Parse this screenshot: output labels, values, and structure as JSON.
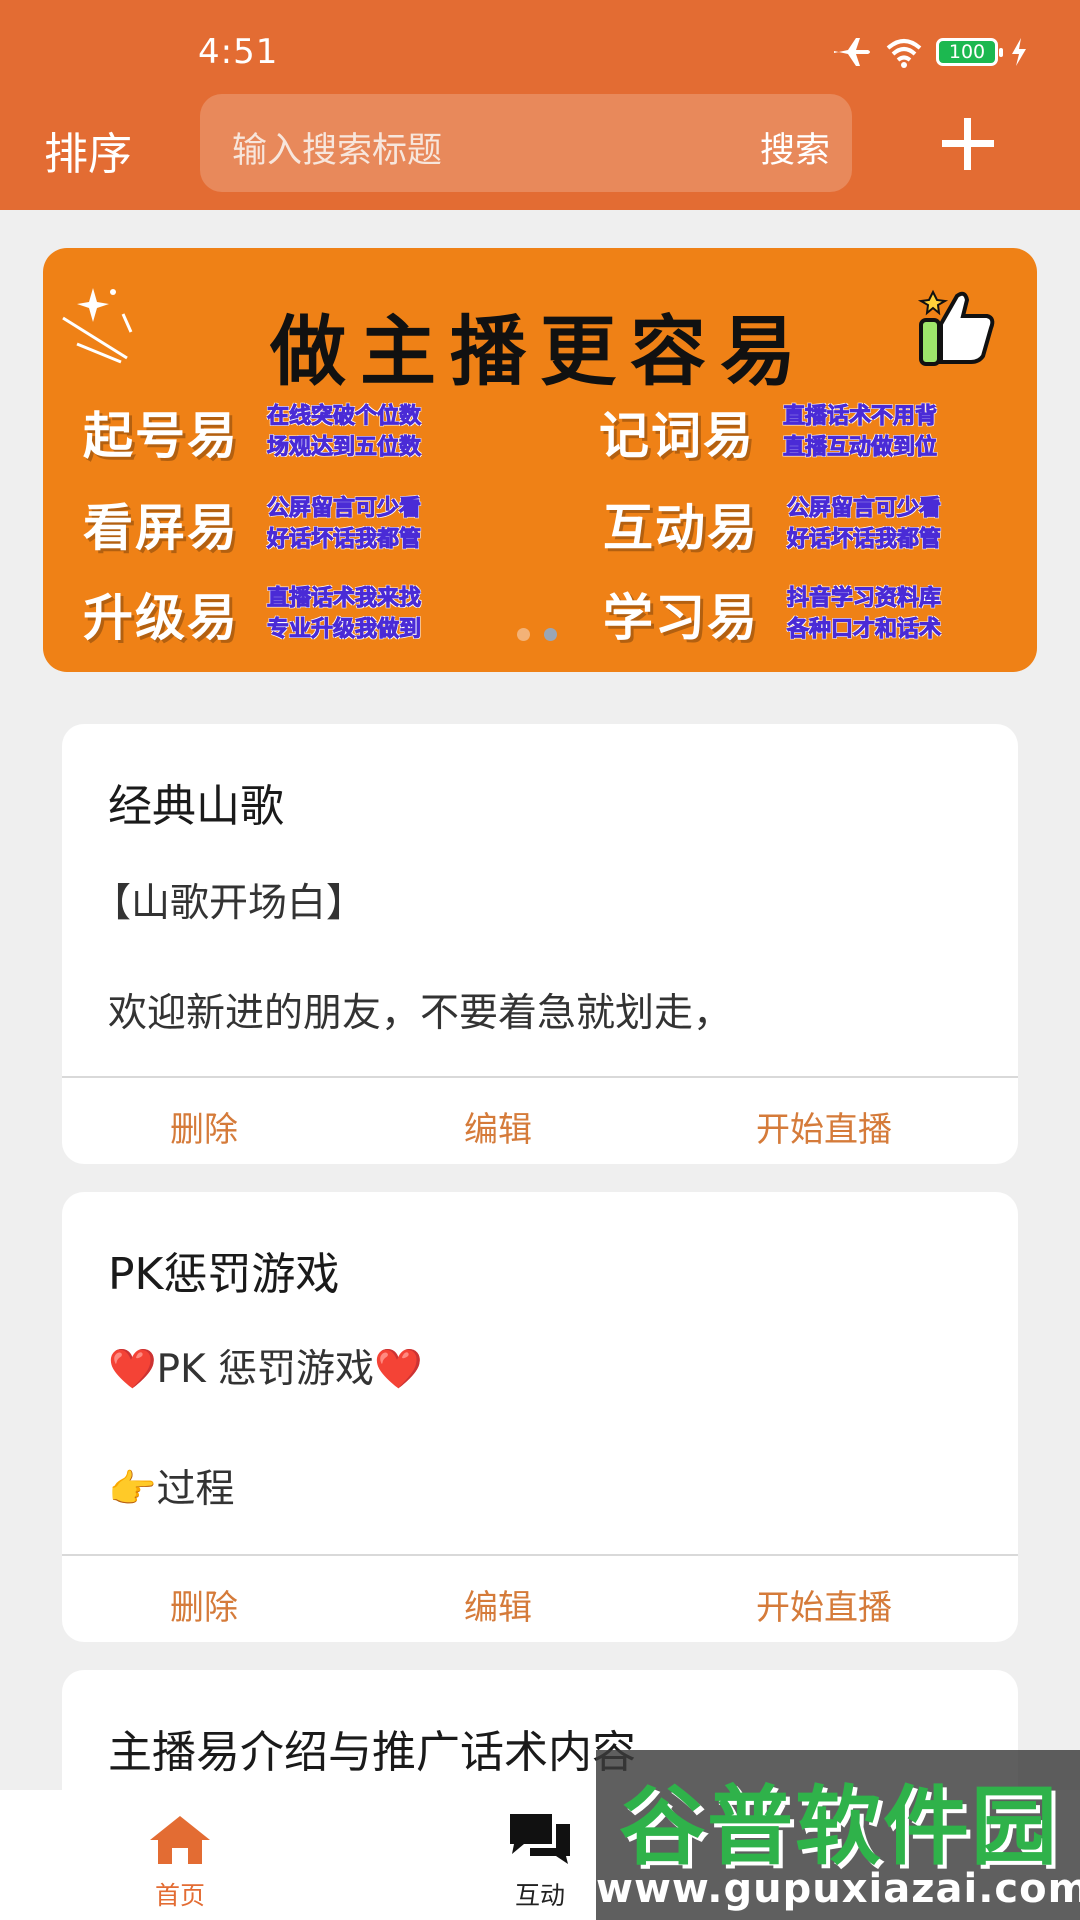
{
  "status_bar": {
    "time": "4:51",
    "battery": "100"
  },
  "header": {
    "sort_label": "排序",
    "search_placeholder": "输入搜索标题",
    "search_button": "搜索"
  },
  "banner": {
    "title": "做主播更容易",
    "cells": [
      {
        "big": "起号易",
        "line1": "在线突破个位数",
        "line2": "场观达到五位数"
      },
      {
        "big": "记词易",
        "line1": "直播话术不用背",
        "line2": "直播互动做到位"
      },
      {
        "big": "看屏易",
        "line1": "公屏留言可少看",
        "line2": "好话坏话我都管"
      },
      {
        "big": "互动易",
        "line1": "公屏留言可少看",
        "line2": "好话坏话我都管"
      },
      {
        "big": "升级易",
        "line1": "直播话术我来找",
        "line2": "专业升级我做到"
      },
      {
        "big": "学习易",
        "line1": "抖音学习资料库",
        "line2": "各种口才和话术"
      }
    ],
    "active_dot": 2,
    "dot_count": 2
  },
  "cards": [
    {
      "title": "经典山歌",
      "line1": "【山歌开场白】",
      "line2": "欢迎新进的朋友，不要着急就划走，",
      "delete": "删除",
      "edit": "编辑",
      "live": "开始直播"
    },
    {
      "title": "PK惩罚游戏",
      "line1": "❤️PK 惩罚游戏❤️",
      "line2": "👉过程",
      "delete": "删除",
      "edit": "编辑",
      "live": "开始直播"
    },
    {
      "title": "主播易介绍与推广话术内容"
    }
  ],
  "bottom_nav": {
    "items": [
      {
        "label": "首页",
        "icon": "home-icon",
        "active": true
      },
      {
        "label": "互动",
        "icon": "chat-icon",
        "active": false
      }
    ]
  },
  "watermark": {
    "text": "谷普软件园",
    "url": "www.gupuxiazai.com"
  },
  "colors": {
    "primary": "#e36c33",
    "banner": "#ef8116",
    "action": "#d57b3a"
  }
}
